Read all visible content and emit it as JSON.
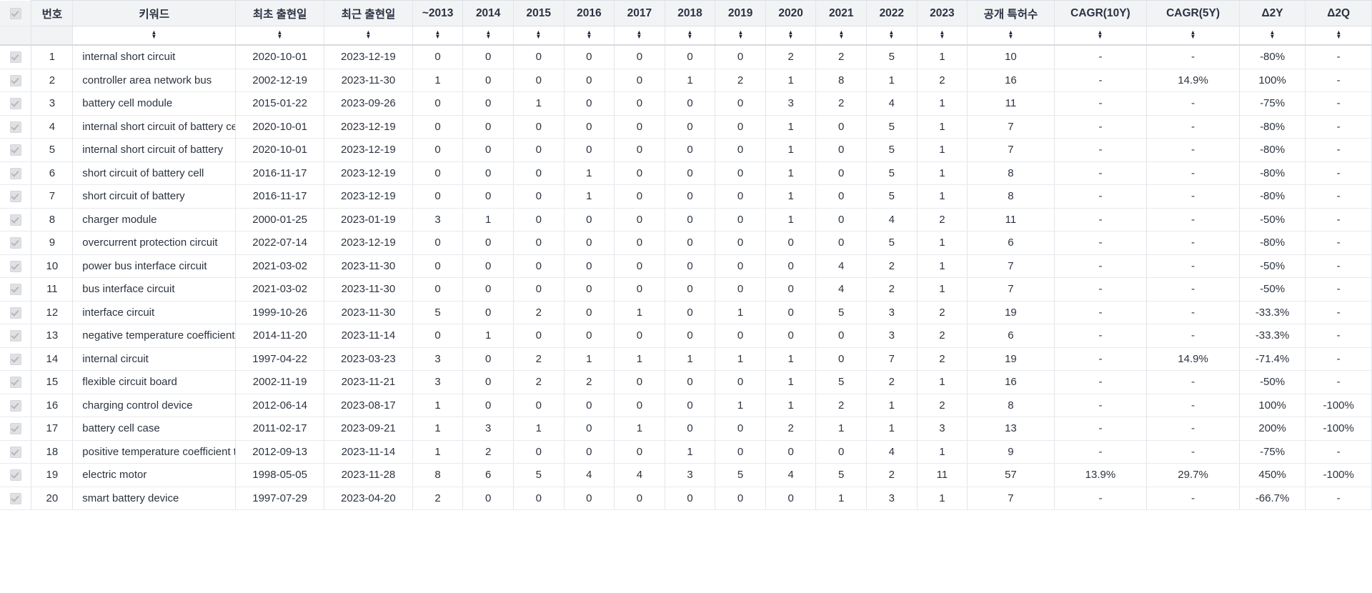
{
  "table": {
    "columns": [
      {
        "key": "check",
        "label": "",
        "sortable": false
      },
      {
        "key": "no",
        "label": "번호",
        "sortable": false
      },
      {
        "key": "keyword",
        "label": "키워드",
        "sortable": true
      },
      {
        "key": "first",
        "label": "최초 출현일",
        "sortable": true
      },
      {
        "key": "last",
        "label": "최근 출현일",
        "sortable": true
      },
      {
        "key": "y2013",
        "label": "~2013",
        "sortable": true
      },
      {
        "key": "y2014",
        "label": "2014",
        "sortable": true
      },
      {
        "key": "y2015",
        "label": "2015",
        "sortable": true
      },
      {
        "key": "y2016",
        "label": "2016",
        "sortable": true
      },
      {
        "key": "y2017",
        "label": "2017",
        "sortable": true
      },
      {
        "key": "y2018",
        "label": "2018",
        "sortable": true
      },
      {
        "key": "y2019",
        "label": "2019",
        "sortable": true
      },
      {
        "key": "y2020",
        "label": "2020",
        "sortable": true
      },
      {
        "key": "y2021",
        "label": "2021",
        "sortable": true
      },
      {
        "key": "y2022",
        "label": "2022",
        "sortable": true
      },
      {
        "key": "y2023",
        "label": "2023",
        "sortable": true
      },
      {
        "key": "total",
        "label": "공개 특허수",
        "sortable": true
      },
      {
        "key": "cagr10",
        "label": "CAGR(10Y)",
        "sortable": true
      },
      {
        "key": "cagr5",
        "label": "CAGR(5Y)",
        "sortable": true
      },
      {
        "key": "d2y",
        "label": "Δ2Y",
        "sortable": true
      },
      {
        "key": "d2q",
        "label": "Δ2Q",
        "sortable": true
      }
    ],
    "sort_icon": {
      "up": "▴",
      "down": "▾"
    },
    "checkbox_icon": "checkbox-checked-disabled-icon",
    "rows": [
      {
        "no": "1",
        "keyword": "internal short circuit",
        "first": "2020-10-01",
        "last": "2023-12-19",
        "years": [
          "0",
          "0",
          "0",
          "0",
          "0",
          "0",
          "0",
          "2",
          "2",
          "5",
          "1"
        ],
        "total": "10",
        "cagr10": "-",
        "cagr5": "-",
        "d2y": "-80%",
        "d2q": "-"
      },
      {
        "no": "2",
        "keyword": "controller area network bus",
        "first": "2002-12-19",
        "last": "2023-11-30",
        "years": [
          "1",
          "0",
          "0",
          "0",
          "0",
          "1",
          "2",
          "1",
          "8",
          "1",
          "2"
        ],
        "total": "16",
        "cagr10": "-",
        "cagr5": "14.9%",
        "d2y": "100%",
        "d2q": "-"
      },
      {
        "no": "3",
        "keyword": "battery cell module",
        "first": "2015-01-22",
        "last": "2023-09-26",
        "years": [
          "0",
          "0",
          "1",
          "0",
          "0",
          "0",
          "0",
          "3",
          "2",
          "4",
          "1"
        ],
        "total": "11",
        "cagr10": "-",
        "cagr5": "-",
        "d2y": "-75%",
        "d2q": "-"
      },
      {
        "no": "4",
        "keyword": "internal short circuit of battery cell",
        "first": "2020-10-01",
        "last": "2023-12-19",
        "years": [
          "0",
          "0",
          "0",
          "0",
          "0",
          "0",
          "0",
          "1",
          "0",
          "5",
          "1"
        ],
        "total": "7",
        "cagr10": "-",
        "cagr5": "-",
        "d2y": "-80%",
        "d2q": "-"
      },
      {
        "no": "5",
        "keyword": "internal short circuit of battery",
        "first": "2020-10-01",
        "last": "2023-12-19",
        "years": [
          "0",
          "0",
          "0",
          "0",
          "0",
          "0",
          "0",
          "1",
          "0",
          "5",
          "1"
        ],
        "total": "7",
        "cagr10": "-",
        "cagr5": "-",
        "d2y": "-80%",
        "d2q": "-"
      },
      {
        "no": "6",
        "keyword": "short circuit of battery cell",
        "first": "2016-11-17",
        "last": "2023-12-19",
        "years": [
          "0",
          "0",
          "0",
          "1",
          "0",
          "0",
          "0",
          "1",
          "0",
          "5",
          "1"
        ],
        "total": "8",
        "cagr10": "-",
        "cagr5": "-",
        "d2y": "-80%",
        "d2q": "-"
      },
      {
        "no": "7",
        "keyword": "short circuit of battery",
        "first": "2016-11-17",
        "last": "2023-12-19",
        "years": [
          "0",
          "0",
          "0",
          "1",
          "0",
          "0",
          "0",
          "1",
          "0",
          "5",
          "1"
        ],
        "total": "8",
        "cagr10": "-",
        "cagr5": "-",
        "d2y": "-80%",
        "d2q": "-"
      },
      {
        "no": "8",
        "keyword": "charger module",
        "first": "2000-01-25",
        "last": "2023-01-19",
        "years": [
          "3",
          "1",
          "0",
          "0",
          "0",
          "0",
          "0",
          "1",
          "0",
          "4",
          "2"
        ],
        "total": "11",
        "cagr10": "-",
        "cagr5": "-",
        "d2y": "-50%",
        "d2q": "-"
      },
      {
        "no": "9",
        "keyword": "overcurrent protection circuit",
        "first": "2022-07-14",
        "last": "2023-12-19",
        "years": [
          "0",
          "0",
          "0",
          "0",
          "0",
          "0",
          "0",
          "0",
          "0",
          "5",
          "1"
        ],
        "total": "6",
        "cagr10": "-",
        "cagr5": "-",
        "d2y": "-80%",
        "d2q": "-"
      },
      {
        "no": "10",
        "keyword": "power bus interface circuit",
        "first": "2021-03-02",
        "last": "2023-11-30",
        "years": [
          "0",
          "0",
          "0",
          "0",
          "0",
          "0",
          "0",
          "0",
          "4",
          "2",
          "1"
        ],
        "total": "7",
        "cagr10": "-",
        "cagr5": "-",
        "d2y": "-50%",
        "d2q": "-"
      },
      {
        "no": "11",
        "keyword": "bus interface circuit",
        "first": "2021-03-02",
        "last": "2023-11-30",
        "years": [
          "0",
          "0",
          "0",
          "0",
          "0",
          "0",
          "0",
          "0",
          "4",
          "2",
          "1"
        ],
        "total": "7",
        "cagr10": "-",
        "cagr5": "-",
        "d2y": "-50%",
        "d2q": "-"
      },
      {
        "no": "12",
        "keyword": "interface circuit",
        "first": "1999-10-26",
        "last": "2023-11-30",
        "years": [
          "5",
          "0",
          "2",
          "0",
          "1",
          "0",
          "1",
          "0",
          "5",
          "3",
          "2"
        ],
        "total": "19",
        "cagr10": "-",
        "cagr5": "-",
        "d2y": "-33.3%",
        "d2q": "-"
      },
      {
        "no": "13",
        "keyword": "negative temperature coefficient thermistor",
        "first": "2014-11-20",
        "last": "2023-11-14",
        "years": [
          "0",
          "1",
          "0",
          "0",
          "0",
          "0",
          "0",
          "0",
          "0",
          "3",
          "2"
        ],
        "total": "6",
        "cagr10": "-",
        "cagr5": "-",
        "d2y": "-33.3%",
        "d2q": "-"
      },
      {
        "no": "14",
        "keyword": "internal circuit",
        "first": "1997-04-22",
        "last": "2023-03-23",
        "years": [
          "3",
          "0",
          "2",
          "1",
          "1",
          "1",
          "1",
          "1",
          "0",
          "7",
          "2"
        ],
        "total": "19",
        "cagr10": "-",
        "cagr5": "14.9%",
        "d2y": "-71.4%",
        "d2q": "-"
      },
      {
        "no": "15",
        "keyword": "flexible circuit board",
        "first": "2002-11-19",
        "last": "2023-11-21",
        "years": [
          "3",
          "0",
          "2",
          "2",
          "0",
          "0",
          "0",
          "1",
          "5",
          "2",
          "1"
        ],
        "total": "16",
        "cagr10": "-",
        "cagr5": "-",
        "d2y": "-50%",
        "d2q": "-"
      },
      {
        "no": "16",
        "keyword": "charging control device",
        "first": "2012-06-14",
        "last": "2023-08-17",
        "years": [
          "1",
          "0",
          "0",
          "0",
          "0",
          "0",
          "1",
          "1",
          "2",
          "1",
          "2"
        ],
        "total": "8",
        "cagr10": "-",
        "cagr5": "-",
        "d2y": "100%",
        "d2q": "-100%"
      },
      {
        "no": "17",
        "keyword": "battery cell case",
        "first": "2011-02-17",
        "last": "2023-09-21",
        "years": [
          "1",
          "3",
          "1",
          "0",
          "1",
          "0",
          "0",
          "2",
          "1",
          "1",
          "3"
        ],
        "total": "13",
        "cagr10": "-",
        "cagr5": "-",
        "d2y": "200%",
        "d2q": "-100%"
      },
      {
        "no": "18",
        "keyword": "positive temperature coefficient thermistor",
        "first": "2012-09-13",
        "last": "2023-11-14",
        "years": [
          "1",
          "2",
          "0",
          "0",
          "0",
          "1",
          "0",
          "0",
          "0",
          "4",
          "1"
        ],
        "total": "9",
        "cagr10": "-",
        "cagr5": "-",
        "d2y": "-75%",
        "d2q": "-"
      },
      {
        "no": "19",
        "keyword": "electric motor",
        "first": "1998-05-05",
        "last": "2023-11-28",
        "years": [
          "8",
          "6",
          "5",
          "4",
          "4",
          "3",
          "5",
          "4",
          "5",
          "2",
          "11"
        ],
        "total": "57",
        "cagr10": "13.9%",
        "cagr5": "29.7%",
        "d2y": "450%",
        "d2q": "-100%"
      },
      {
        "no": "20",
        "keyword": "smart battery device",
        "first": "1997-07-29",
        "last": "2023-04-20",
        "years": [
          "2",
          "0",
          "0",
          "0",
          "0",
          "0",
          "0",
          "0",
          "1",
          "3",
          "1"
        ],
        "total": "7",
        "cagr10": "-",
        "cagr5": "-",
        "d2y": "-66.7%",
        "d2q": "-"
      }
    ]
  },
  "colors": {
    "header_bg": "#f2f3f5",
    "text": "#2c3440",
    "border": "#e2e5ea"
  }
}
